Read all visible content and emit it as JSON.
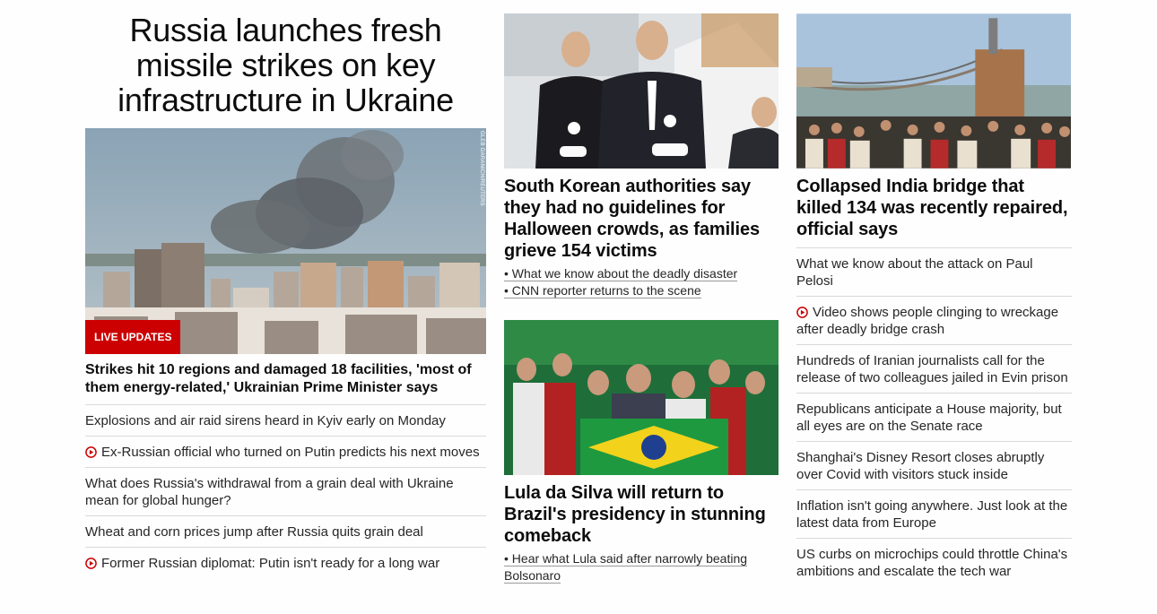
{
  "lead": {
    "title": "Russia launches fresh missile strikes on key infrastructure in Ukraine",
    "photo_credit": "GLEB GARANICH/REUTERS",
    "badge": "LIVE UPDATES",
    "subheadline": "Strikes hit 10 regions and damaged 18 facilities, 'most of them energy-related,' Ukrainian Prime Minister says",
    "stories": [
      {
        "text": "Explosions and air raid sirens heard in Kyiv early on Monday",
        "video": false
      },
      {
        "text": "Ex-Russian official who turned on Putin predicts his next moves",
        "video": true
      },
      {
        "text": "What does Russia's withdrawal from a grain deal with Ukraine mean for global hunger?",
        "video": false
      },
      {
        "text": "Wheat and corn prices jump after Russia quits grain deal",
        "video": false
      },
      {
        "text": "Former Russian diplomat: Putin isn't ready for a long war",
        "video": true
      }
    ]
  },
  "korea": {
    "title": "South Korean authorities say they had no guidelines for Halloween crowds, as families grieve 154 victims",
    "links": [
      "• What we know about the deadly disaster",
      "• CNN reporter returns to the scene"
    ]
  },
  "lula": {
    "title": "Lula da Silva will return to Brazil's presidency in stunning comeback",
    "links": [
      "• Hear what Lula said after narrowly beating Bolsonaro"
    ]
  },
  "india": {
    "title": "Collapsed India bridge that killed 134 was recently repaired, official says",
    "stories": [
      {
        "text": "What we know about the attack on Paul Pelosi",
        "video": false
      },
      {
        "text": "Video shows people clinging to wreckage after deadly bridge crash",
        "video": true
      },
      {
        "text": "Hundreds of Iranian journalists call for the release of two colleagues jailed in Evin prison",
        "video": false
      },
      {
        "text": "Republicans anticipate a House majority, but all eyes are on the Senate race",
        "video": false
      },
      {
        "text": "Shanghai's Disney Resort closes abruptly over Covid with visitors stuck inside",
        "video": false
      },
      {
        "text": "Inflation isn't going anywhere. Just look at the latest data from Europe",
        "video": false
      },
      {
        "text": "US curbs on microchips could throttle China's ambitions and escalate the tech war",
        "video": false
      }
    ]
  },
  "colors": {
    "accent": "#cc0000",
    "divider": "#d9d9d9",
    "text": "#0c0c0c"
  }
}
